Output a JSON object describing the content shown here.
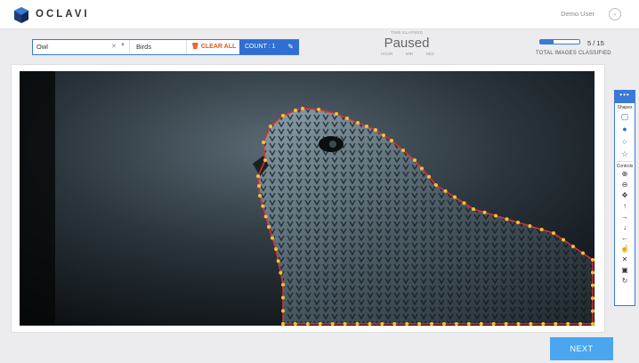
{
  "app": {
    "brand": "OCLAVI",
    "user": "Demo User"
  },
  "toolbar": {
    "label_value": "Owl",
    "class_value": "Birds",
    "clear_all": "CLEAR ALL",
    "count": "COUNT : 1"
  },
  "timer": {
    "label": "TIME ELAPSED",
    "status": "Paused",
    "units": [
      "HOUR",
      "MIN",
      "SEC"
    ]
  },
  "progress": {
    "done": 5,
    "total": 15,
    "text": "5 / 15",
    "label": "TOTAL IMAGES CLASSIFIED"
  },
  "side_panel": {
    "menu": "•••",
    "shapes_title": "Shapes",
    "controls_title": "Controls"
  },
  "next_label": "NEXT",
  "colors": {
    "accent": "#2f6fd4",
    "clear": "#e05a1e",
    "polygon": "#e03030",
    "vertex": "#f4c236",
    "next": "#49a6ef"
  }
}
